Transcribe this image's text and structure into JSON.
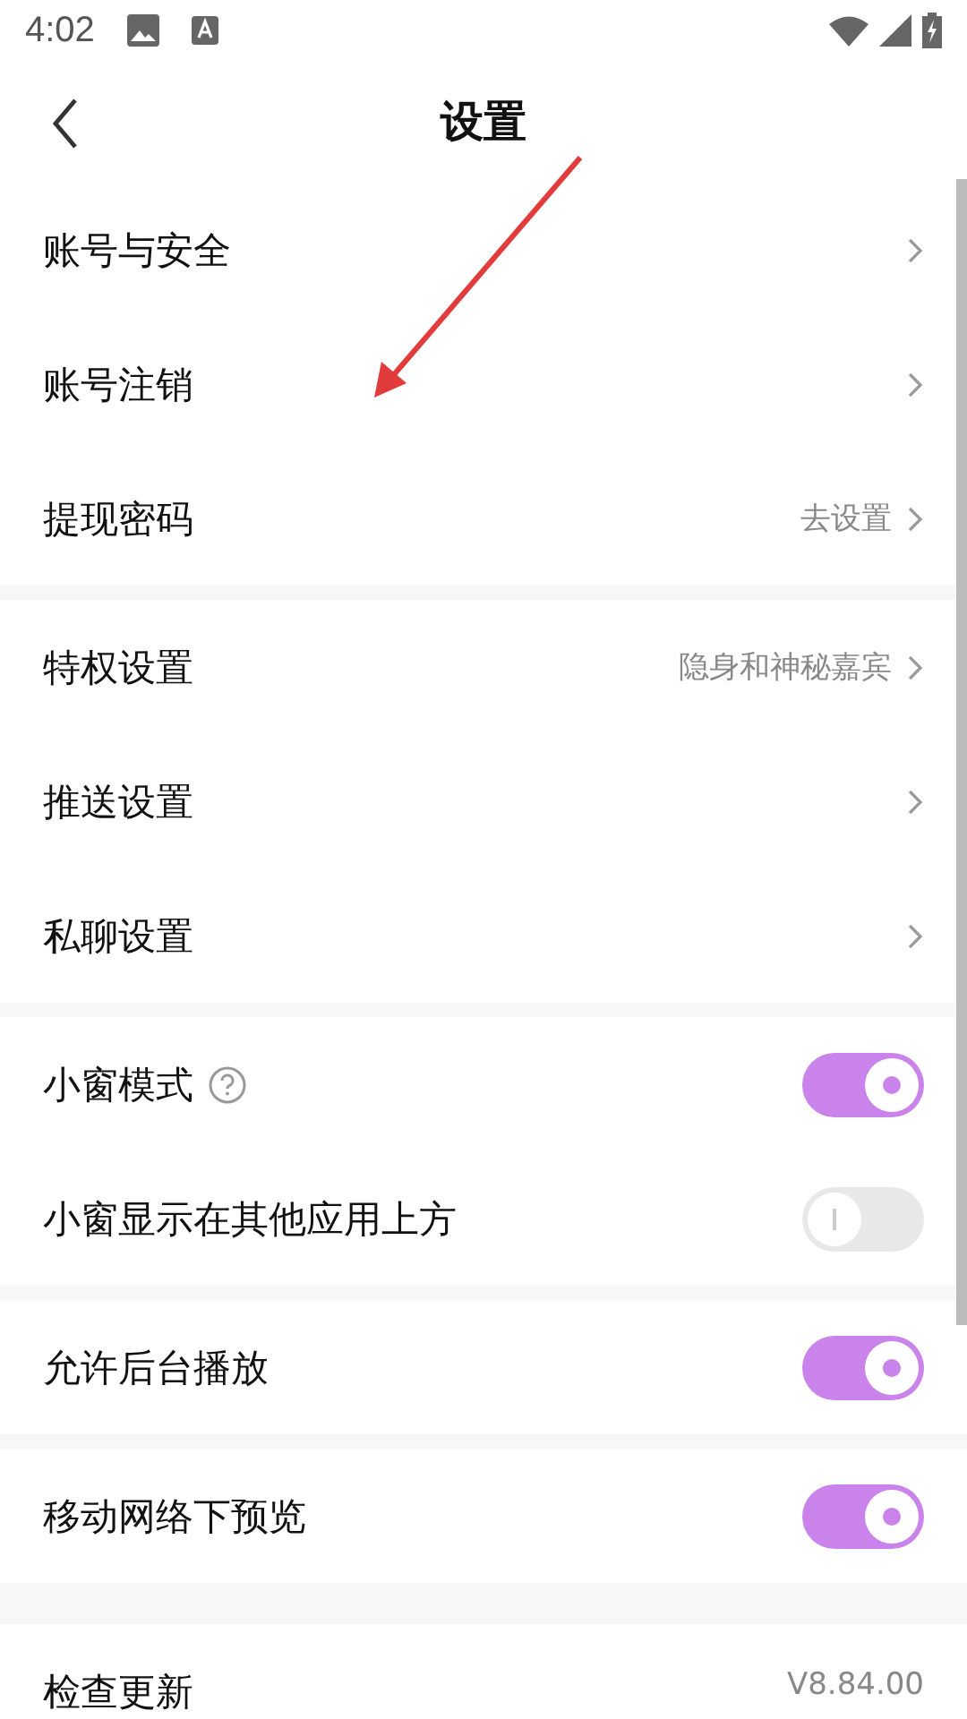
{
  "status_bar": {
    "time": "4:02"
  },
  "header": {
    "title": "设置"
  },
  "groups": [
    {
      "items": [
        {
          "kind": "link",
          "label": "账号与安全"
        },
        {
          "kind": "link",
          "label": "账号注销"
        },
        {
          "kind": "link",
          "label": "提现密码",
          "value": "去设置"
        }
      ]
    },
    {
      "items": [
        {
          "kind": "link",
          "label": "特权设置",
          "value": "隐身和神秘嘉宾"
        },
        {
          "kind": "link",
          "label": "推送设置"
        },
        {
          "kind": "link",
          "label": "私聊设置"
        }
      ]
    },
    {
      "items": [
        {
          "kind": "toggle",
          "label": "小窗模式",
          "help": true,
          "on": true
        },
        {
          "kind": "toggle",
          "label": "小窗显示在其他应用上方",
          "on": false
        }
      ]
    },
    {
      "items": [
        {
          "kind": "toggle",
          "label": "允许后台播放",
          "on": true
        }
      ]
    },
    {
      "items": [
        {
          "kind": "toggle",
          "label": "移动网络下预览",
          "on": true
        }
      ]
    },
    {
      "items": [
        {
          "kind": "info",
          "label": "检查更新",
          "value": "V8.84.00"
        }
      ]
    }
  ]
}
